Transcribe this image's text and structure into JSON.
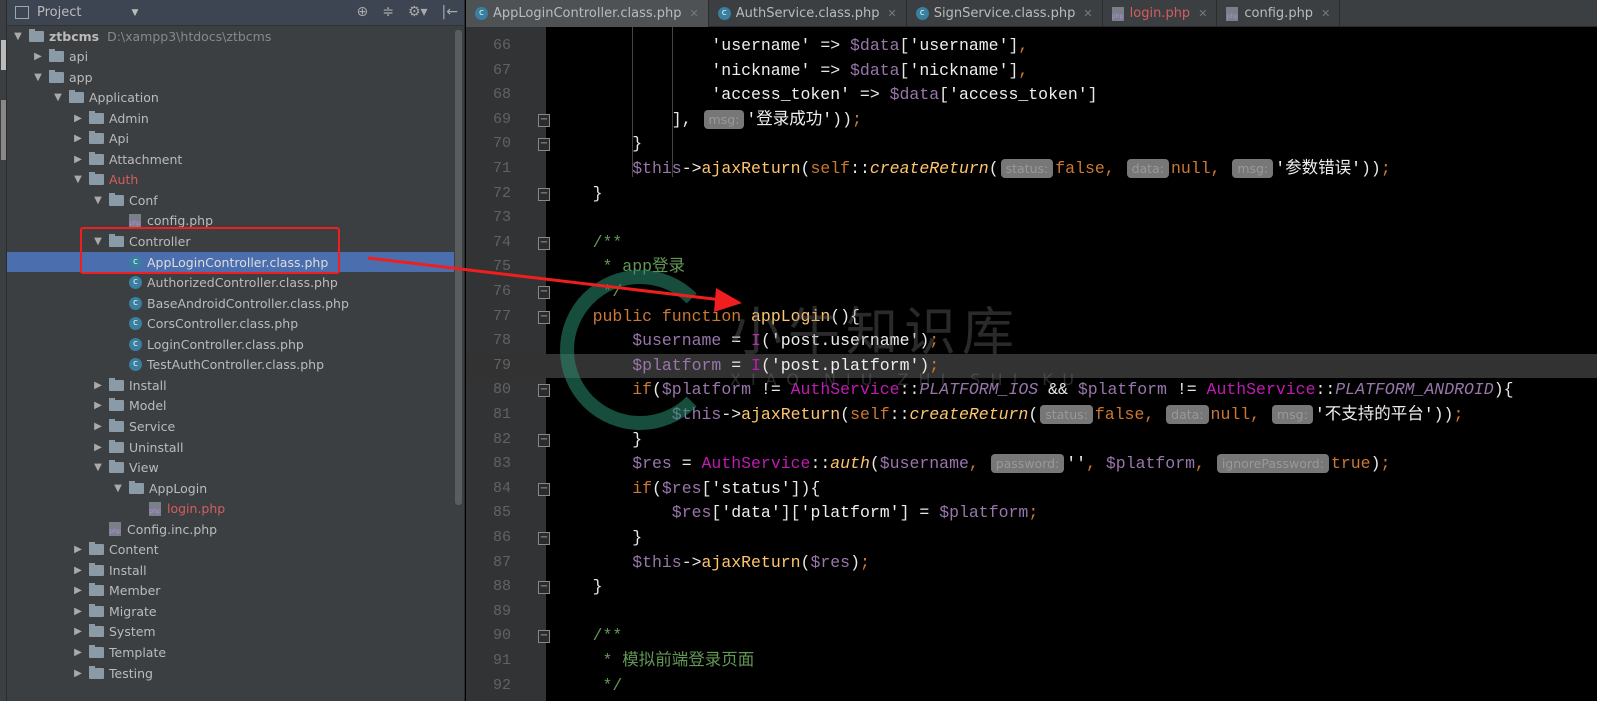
{
  "project_panel": {
    "title": "Project",
    "tools": [
      "⊕",
      "≑",
      "⚙▾",
      "|←"
    ]
  },
  "tree": [
    {
      "label": "ztbcms",
      "path": "D:\\xampp3\\htdocs\\ztbcms",
      "depth": 0,
      "type": "folder",
      "arrow": "down",
      "bold": true
    },
    {
      "label": "api",
      "depth": 1,
      "type": "folder",
      "arrow": "right"
    },
    {
      "label": "app",
      "depth": 1,
      "type": "folder",
      "arrow": "down"
    },
    {
      "label": "Application",
      "depth": 2,
      "type": "folder",
      "arrow": "down"
    },
    {
      "label": "Admin",
      "depth": 3,
      "type": "folder",
      "arrow": "right"
    },
    {
      "label": "Api",
      "depth": 3,
      "type": "folder",
      "arrow": "right"
    },
    {
      "label": "Attachment",
      "depth": 3,
      "type": "folder",
      "arrow": "right"
    },
    {
      "label": "Auth",
      "depth": 3,
      "type": "folder",
      "arrow": "down",
      "color": "#d45d5d"
    },
    {
      "label": "Conf",
      "depth": 4,
      "type": "folder",
      "arrow": "down"
    },
    {
      "label": "config.php",
      "depth": 5,
      "type": "php"
    },
    {
      "label": "Controller",
      "depth": 4,
      "type": "folder",
      "arrow": "down"
    },
    {
      "label": "AppLoginController.class.php",
      "depth": 5,
      "type": "class",
      "selected": true
    },
    {
      "label": "AuthorizedController.class.php",
      "depth": 5,
      "type": "class"
    },
    {
      "label": "BaseAndroidController.class.php",
      "depth": 5,
      "type": "class"
    },
    {
      "label": "CorsController.class.php",
      "depth": 5,
      "type": "class"
    },
    {
      "label": "LoginController.class.php",
      "depth": 5,
      "type": "class"
    },
    {
      "label": "TestAuthController.class.php",
      "depth": 5,
      "type": "class"
    },
    {
      "label": "Install",
      "depth": 4,
      "type": "folder",
      "arrow": "right"
    },
    {
      "label": "Model",
      "depth": 4,
      "type": "folder",
      "arrow": "right"
    },
    {
      "label": "Service",
      "depth": 4,
      "type": "folder",
      "arrow": "right"
    },
    {
      "label": "Uninstall",
      "depth": 4,
      "type": "folder",
      "arrow": "right"
    },
    {
      "label": "View",
      "depth": 4,
      "type": "folder",
      "arrow": "down"
    },
    {
      "label": "AppLogin",
      "depth": 5,
      "type": "folder",
      "arrow": "down"
    },
    {
      "label": "login.php",
      "depth": 6,
      "type": "php",
      "color": "#d45d5d"
    },
    {
      "label": "Config.inc.php",
      "depth": 4,
      "type": "php"
    },
    {
      "label": "Content",
      "depth": 3,
      "type": "folder",
      "arrow": "right"
    },
    {
      "label": "Install",
      "depth": 3,
      "type": "folder",
      "arrow": "right"
    },
    {
      "label": "Member",
      "depth": 3,
      "type": "folder",
      "arrow": "right"
    },
    {
      "label": "Migrate",
      "depth": 3,
      "type": "folder",
      "arrow": "right"
    },
    {
      "label": "System",
      "depth": 3,
      "type": "folder",
      "arrow": "right"
    },
    {
      "label": "Template",
      "depth": 3,
      "type": "folder",
      "arrow": "right"
    },
    {
      "label": "Testing",
      "depth": 3,
      "type": "folder",
      "arrow": "right"
    }
  ],
  "tabs": [
    {
      "label": "AppLoginController.class.php",
      "icon": "class",
      "active": true
    },
    {
      "label": "AuthService.class.php",
      "icon": "class"
    },
    {
      "label": "SignService.class.php",
      "icon": "class"
    },
    {
      "label": "login.php",
      "icon": "php",
      "modified": true
    },
    {
      "label": "config.php",
      "icon": "php"
    }
  ],
  "code": [
    {
      "n": 66,
      "i": 4,
      "t": [
        [
          "str",
          "'username'"
        ],
        [
          "pun",
          " => "
        ],
        [
          "var",
          "$data"
        ],
        [
          "pun",
          "["
        ],
        [
          "str",
          "'username'"
        ],
        [
          "pun",
          "]"
        ],
        [
          "semi",
          ","
        ]
      ]
    },
    {
      "n": 67,
      "i": 4,
      "t": [
        [
          "str",
          "'nickname'"
        ],
        [
          "pun",
          " => "
        ],
        [
          "var",
          "$data"
        ],
        [
          "pun",
          "["
        ],
        [
          "str",
          "'nickname'"
        ],
        [
          "pun",
          "]"
        ],
        [
          "semi",
          ","
        ]
      ]
    },
    {
      "n": 68,
      "i": 4,
      "t": [
        [
          "str",
          "'access_token'"
        ],
        [
          "pun",
          " => "
        ],
        [
          "var",
          "$data"
        ],
        [
          "pun",
          "["
        ],
        [
          "str",
          "'access_token'"
        ],
        [
          "pun",
          "]"
        ]
      ]
    },
    {
      "n": 69,
      "i": 3,
      "fold": true,
      "t": [
        [
          "pun",
          "], "
        ],
        [
          "hint",
          "msg:"
        ],
        [
          "str",
          "'登录成功'"
        ],
        [
          "pun",
          "))"
        ],
        [
          "semi",
          ";"
        ]
      ]
    },
    {
      "n": 70,
      "i": 2,
      "fold": true,
      "t": [
        [
          "pun",
          "}"
        ]
      ]
    },
    {
      "n": 71,
      "i": 2,
      "t": [
        [
          "var",
          "$this"
        ],
        [
          "pun",
          "->"
        ],
        [
          "fn",
          "ajaxReturn"
        ],
        [
          "pun",
          "("
        ],
        [
          "kw",
          "self"
        ],
        [
          "pun",
          "::"
        ],
        [
          "it",
          "createReturn"
        ],
        [
          "pun",
          "("
        ],
        [
          "hint",
          "status:"
        ],
        [
          "kw",
          "false"
        ],
        [
          "semi",
          ", "
        ],
        [
          "hint",
          "data:"
        ],
        [
          "kw",
          "null"
        ],
        [
          "semi",
          ", "
        ],
        [
          "hint",
          "msg:"
        ],
        [
          "str",
          "'参数错误'"
        ],
        [
          "pun",
          "))"
        ],
        [
          "semi",
          ";"
        ]
      ]
    },
    {
      "n": 72,
      "i": 1,
      "fold": true,
      "t": [
        [
          "pun",
          "}"
        ]
      ]
    },
    {
      "n": 73,
      "i": 0,
      "t": []
    },
    {
      "n": 74,
      "i": 1,
      "fold": true,
      "t": [
        [
          "com",
          "/**"
        ]
      ]
    },
    {
      "n": 75,
      "i": 1,
      "t": [
        [
          "com",
          " * app登录"
        ]
      ]
    },
    {
      "n": 76,
      "i": 1,
      "fold": true,
      "t": [
        [
          "com",
          " */"
        ]
      ]
    },
    {
      "n": 77,
      "i": 1,
      "fold": true,
      "t": [
        [
          "kw",
          "public function "
        ],
        [
          "fn",
          "appLogin"
        ],
        [
          "pun",
          "(){"
        ]
      ]
    },
    {
      "n": 78,
      "i": 2,
      "t": [
        [
          "var",
          "$username"
        ],
        [
          "pun",
          " = "
        ],
        [
          "cls2",
          "I"
        ],
        [
          "pun",
          "("
        ],
        [
          "str",
          "'post.username'"
        ],
        [
          "pun",
          ")"
        ],
        [
          "semi",
          ";"
        ]
      ]
    },
    {
      "n": 79,
      "i": 2,
      "current": true,
      "t": [
        [
          "var",
          "$platform"
        ],
        [
          "pun",
          " = "
        ],
        [
          "cls2",
          "I"
        ],
        [
          "pun",
          "("
        ],
        [
          "str",
          "'post.platform'"
        ],
        [
          "pun",
          ")"
        ],
        [
          "semi",
          ";"
        ]
      ]
    },
    {
      "n": 80,
      "i": 2,
      "fold": true,
      "t": [
        [
          "kw",
          "if"
        ],
        [
          "pun",
          "("
        ],
        [
          "var",
          "$platform"
        ],
        [
          "pun",
          " != "
        ],
        [
          "cls2",
          "AuthService"
        ],
        [
          "pun",
          "::"
        ],
        [
          "const",
          "PLATFORM_IOS"
        ],
        [
          "pun",
          " && "
        ],
        [
          "var",
          "$platform"
        ],
        [
          "pun",
          " != "
        ],
        [
          "cls2",
          "AuthService"
        ],
        [
          "pun",
          "::"
        ],
        [
          "const",
          "PLATFORM_ANDROID"
        ],
        [
          "pun",
          "){"
        ]
      ]
    },
    {
      "n": 81,
      "i": 3,
      "t": [
        [
          "var",
          "$this"
        ],
        [
          "pun",
          "->"
        ],
        [
          "fn",
          "ajaxReturn"
        ],
        [
          "pun",
          "("
        ],
        [
          "kw",
          "self"
        ],
        [
          "pun",
          "::"
        ],
        [
          "it",
          "createReturn"
        ],
        [
          "pun",
          "("
        ],
        [
          "hint",
          "status:"
        ],
        [
          "kw",
          "false"
        ],
        [
          "semi",
          ", "
        ],
        [
          "hint",
          "data:"
        ],
        [
          "kw",
          "null"
        ],
        [
          "semi",
          ", "
        ],
        [
          "hint",
          "msg:"
        ],
        [
          "str",
          "'不支持的平台'"
        ],
        [
          "pun",
          "))"
        ],
        [
          "semi",
          ";"
        ]
      ]
    },
    {
      "n": 82,
      "i": 2,
      "fold": true,
      "t": [
        [
          "pun",
          "}"
        ]
      ]
    },
    {
      "n": 83,
      "i": 2,
      "t": [
        [
          "var",
          "$res"
        ],
        [
          "pun",
          " = "
        ],
        [
          "cls2",
          "AuthService"
        ],
        [
          "pun",
          "::"
        ],
        [
          "it",
          "auth"
        ],
        [
          "pun",
          "("
        ],
        [
          "var",
          "$username"
        ],
        [
          "semi",
          ", "
        ],
        [
          "hint",
          "password:"
        ],
        [
          "str",
          "''"
        ],
        [
          "semi",
          ", "
        ],
        [
          "var",
          "$platform"
        ],
        [
          "semi",
          ", "
        ],
        [
          "hint",
          "ignorePassword:"
        ],
        [
          "kw",
          "true"
        ],
        [
          "pun",
          ")"
        ],
        [
          "semi",
          ";"
        ]
      ]
    },
    {
      "n": 84,
      "i": 2,
      "fold": true,
      "t": [
        [
          "kw",
          "if"
        ],
        [
          "pun",
          "("
        ],
        [
          "var",
          "$res"
        ],
        [
          "pun",
          "["
        ],
        [
          "str",
          "'status'"
        ],
        [
          "pun",
          "]){"
        ]
      ]
    },
    {
      "n": 85,
      "i": 3,
      "t": [
        [
          "var",
          "$res"
        ],
        [
          "pun",
          "["
        ],
        [
          "str",
          "'data'"
        ],
        [
          "pun",
          "]["
        ],
        [
          "str",
          "'platform'"
        ],
        [
          "pun",
          "] = "
        ],
        [
          "var",
          "$platform"
        ],
        [
          "semi",
          ";"
        ]
      ]
    },
    {
      "n": 86,
      "i": 2,
      "fold": true,
      "t": [
        [
          "pun",
          "}"
        ]
      ]
    },
    {
      "n": 87,
      "i": 2,
      "t": [
        [
          "var",
          "$this"
        ],
        [
          "pun",
          "->"
        ],
        [
          "fn",
          "ajaxReturn"
        ],
        [
          "pun",
          "("
        ],
        [
          "var",
          "$res"
        ],
        [
          "pun",
          ")"
        ],
        [
          "semi",
          ";"
        ]
      ]
    },
    {
      "n": 88,
      "i": 1,
      "fold": true,
      "t": [
        [
          "pun",
          "}"
        ]
      ]
    },
    {
      "n": 89,
      "i": 0,
      "t": []
    },
    {
      "n": 90,
      "i": 1,
      "fold": true,
      "t": [
        [
          "com",
          "/**"
        ]
      ]
    },
    {
      "n": 91,
      "i": 1,
      "t": [
        [
          "com",
          " * 模拟前端登录页面"
        ]
      ]
    },
    {
      "n": 92,
      "i": 1,
      "t": [
        [
          "com",
          " */"
        ]
      ]
    }
  ],
  "watermark": {
    "text": "小牛知识库",
    "sub": "XIAO NIU ZHI SHI KU"
  },
  "annotation_color": "#f01e1e"
}
